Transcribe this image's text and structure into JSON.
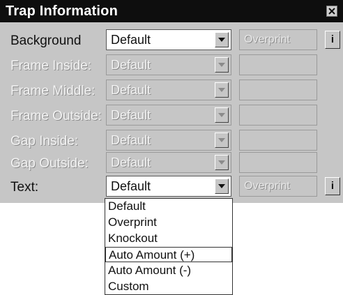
{
  "window": {
    "title": "Trap Information"
  },
  "rows": [
    {
      "label": "Background",
      "enabled": true,
      "value": "Default",
      "side_value": "Overprint",
      "has_info": true
    },
    {
      "label": "Frame Inside:",
      "enabled": false,
      "value": "Default",
      "side_value": "",
      "has_info": false
    },
    {
      "label": "Frame Middle:",
      "enabled": false,
      "value": "Default",
      "side_value": "",
      "has_info": false
    },
    {
      "label": "Frame Outside:",
      "enabled": false,
      "value": "Default",
      "side_value": "",
      "has_info": false
    },
    {
      "label": "Gap Inside:",
      "enabled": false,
      "value": "Default",
      "side_value": "",
      "has_info": false
    },
    {
      "label": "Gap Outside:",
      "enabled": false,
      "value": "Default",
      "side_value": "",
      "has_info": false
    },
    {
      "label": "Text:",
      "enabled": true,
      "value": "Default",
      "side_value": "Overprint",
      "has_info": true
    }
  ],
  "info_button": {
    "label": "i"
  },
  "dropdown": {
    "options": [
      "Default",
      "Overprint",
      "Knockout",
      "Auto Amount (+)",
      "Auto Amount (-)",
      "Custom"
    ],
    "focused_option": "Auto Amount (+)"
  }
}
